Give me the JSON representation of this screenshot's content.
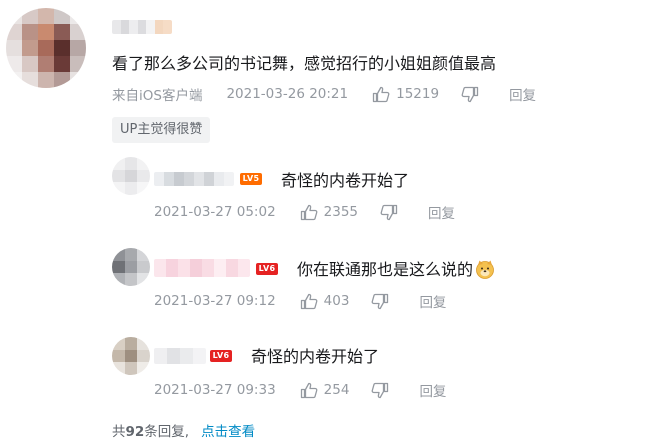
{
  "main_comment": {
    "text": "看了那么多公司的书记舞，感觉招行的小姐姐颜值最高",
    "source": "来自iOS客户端",
    "date": "2021-03-26 20:21",
    "likes": "15219",
    "reply_label": "回复",
    "badge": "UP主觉得很赞"
  },
  "replies": [
    {
      "level": "LV5",
      "text": "奇怪的内卷开始了",
      "date": "2021-03-27 05:02",
      "likes": "2355",
      "reply_label": "回复"
    },
    {
      "level": "LV6",
      "text": "你在联通那也是这么说的",
      "date": "2021-03-27 09:12",
      "likes": "403",
      "reply_label": "回复"
    },
    {
      "level": "LV6",
      "text": "奇怪的内卷开始了",
      "date": "2021-03-27 09:33",
      "likes": "254",
      "reply_label": "回复"
    }
  ],
  "footer": {
    "prefix": "共",
    "count": "92",
    "suffix": "条回复,",
    "link": "点击查看"
  },
  "icons": {
    "like": "thumb-up-icon",
    "dislike": "thumb-down-icon",
    "emoji": "doge-emoji-icon"
  },
  "colors": {
    "link": "#008ac5",
    "meta": "#9499a0",
    "lv5": "#ff6c00",
    "lv6": "#e52222"
  }
}
